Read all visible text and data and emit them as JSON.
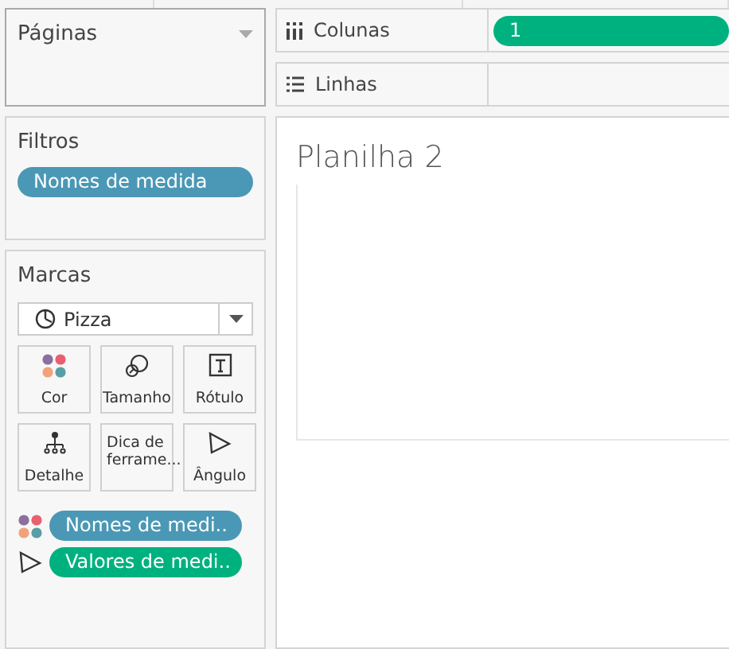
{
  "pages": {
    "title": "Páginas"
  },
  "filters": {
    "title": "Filtros",
    "pills": [
      {
        "label": "Nomes de medida",
        "color": "#4a98b5"
      }
    ]
  },
  "marks": {
    "title": "Marcas",
    "mark_type": {
      "label": "Pizza"
    },
    "cards": [
      {
        "kind": "color",
        "label": "Cor"
      },
      {
        "kind": "size",
        "label": "Tamanho"
      },
      {
        "kind": "label",
        "label": "Rótulo"
      },
      {
        "kind": "detail",
        "label": "Detalhe"
      },
      {
        "kind": "tooltip",
        "label": "Dica de ferrame..."
      },
      {
        "kind": "angle",
        "label": "Ângulo"
      }
    ],
    "pills": [
      {
        "kind": "color",
        "label": "Nomes de medi..",
        "color": "#4a98b5"
      },
      {
        "kind": "angle",
        "label": "Valores de medi..",
        "color": "#00b180"
      }
    ]
  },
  "shelves": [
    {
      "kind": "columns",
      "label": "Colunas",
      "pills": [
        {
          "label": "1",
          "color": "#00b180"
        }
      ]
    },
    {
      "kind": "rows",
      "label": "Linhas"
    }
  ],
  "sheet": {
    "title": "Planilha 2"
  }
}
